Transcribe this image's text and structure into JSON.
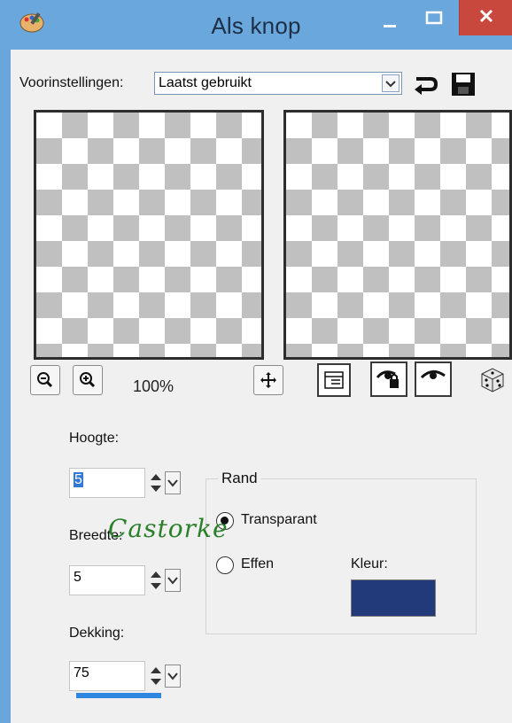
{
  "window": {
    "title": "Als knop"
  },
  "presets": {
    "label": "Voorinstellingen:",
    "value": "Laatst gebruikt"
  },
  "preview": {
    "zoom": "100%"
  },
  "fields": {
    "height_label": "Hoogte:",
    "height_value": "5",
    "width_label": "Breedte:",
    "width_value": "5",
    "opacity_label": "Dekking:",
    "opacity_value": "75"
  },
  "border": {
    "title": "Rand",
    "option_transparent": "Transparant",
    "option_solid": "Effen",
    "color_label": "Kleur:",
    "selected": "Transparant",
    "color": "#233a7a"
  },
  "watermark": {
    "text": "Castorke"
  },
  "icons": [
    "app-palette-icon",
    "minimize-icon",
    "maximize-icon",
    "close-icon",
    "reset-icon",
    "save-icon",
    "zoom-out-icon",
    "zoom-in-icon",
    "pan-icon",
    "proof-icon",
    "lock-preview-icon",
    "preview-eye-icon",
    "randomize-dice-icon"
  ]
}
